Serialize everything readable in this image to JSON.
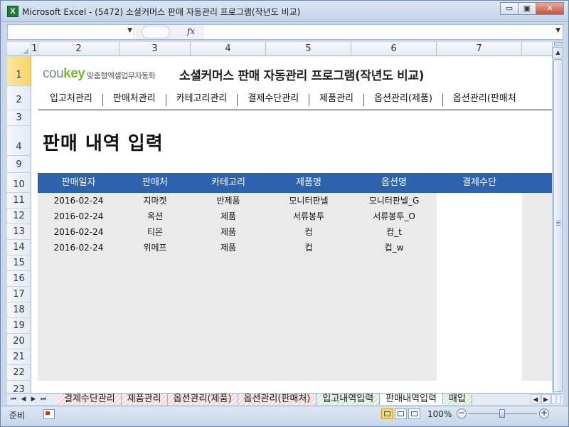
{
  "window": {
    "title": "Microsoft Excel - (5472) 소셜커머스 판매 자동관리 프로그램(작년도 비교)",
    "app_icon": "X",
    "minimize": "▭",
    "restore": "▣",
    "close": "✕"
  },
  "formula_bar": {
    "name_box": "",
    "fx_label": "fx",
    "content": ""
  },
  "columns": [
    "1",
    "2",
    "3",
    "4",
    "5",
    "6",
    "7"
  ],
  "rows": [
    "1",
    "2",
    "3",
    "4",
    "9",
    "10",
    "11",
    "12",
    "13",
    "14",
    "15",
    "16",
    "17",
    "18",
    "19",
    "20",
    "21",
    "22",
    "23"
  ],
  "header": {
    "logo_text": "cou",
    "logo_accent": "key",
    "tagline": "맞춤형엑셀업무자동화",
    "title": "소셜커머스 판매 자동관리 프로그램(작년도 비교)"
  },
  "menu": [
    "입고처관리",
    "판매처관리",
    "카테고리관리",
    "결제수단관리",
    "제품관리",
    "옵션관리(제품)",
    "옵션관리(판매처"
  ],
  "sheet_heading": "판매 내역 입력",
  "table": {
    "columns": [
      "판매일자",
      "판매처",
      "카테고리",
      "제품명",
      "옵션명",
      "결제수단"
    ],
    "rows": [
      [
        "2016-02-24",
        "지마켓",
        "반제품",
        "모니터판넬",
        "모니터판넬_G",
        ""
      ],
      [
        "2016-02-24",
        "옥션",
        "제품",
        "서류봉투",
        "서류봉투_O",
        ""
      ],
      [
        "2016-02-24",
        "티몬",
        "제품",
        "컵",
        "컵_t",
        ""
      ],
      [
        "2016-02-24",
        "위메프",
        "제품",
        "컵",
        "컵_w",
        ""
      ]
    ],
    "empty_row_count": 8
  },
  "sheet_tabs": [
    "결제수단관리",
    "제품관리",
    "옵션관리(제품)",
    "옵션관리(판매처)",
    "입고내역입력",
    "판매내역입력",
    "매입"
  ],
  "active_tab": "판매내역입력",
  "status": {
    "ready": "준비",
    "zoom": "100%",
    "zoom_level": 1.0
  },
  "colors": {
    "header_blue": "#2e62ad",
    "accent_green": "#7fb43a",
    "row_gray": "#eaeaea"
  },
  "icons": [
    "excel-app-icon",
    "minimize-icon",
    "restore-icon",
    "close-icon",
    "fx-icon",
    "chevron-down-icon"
  ]
}
